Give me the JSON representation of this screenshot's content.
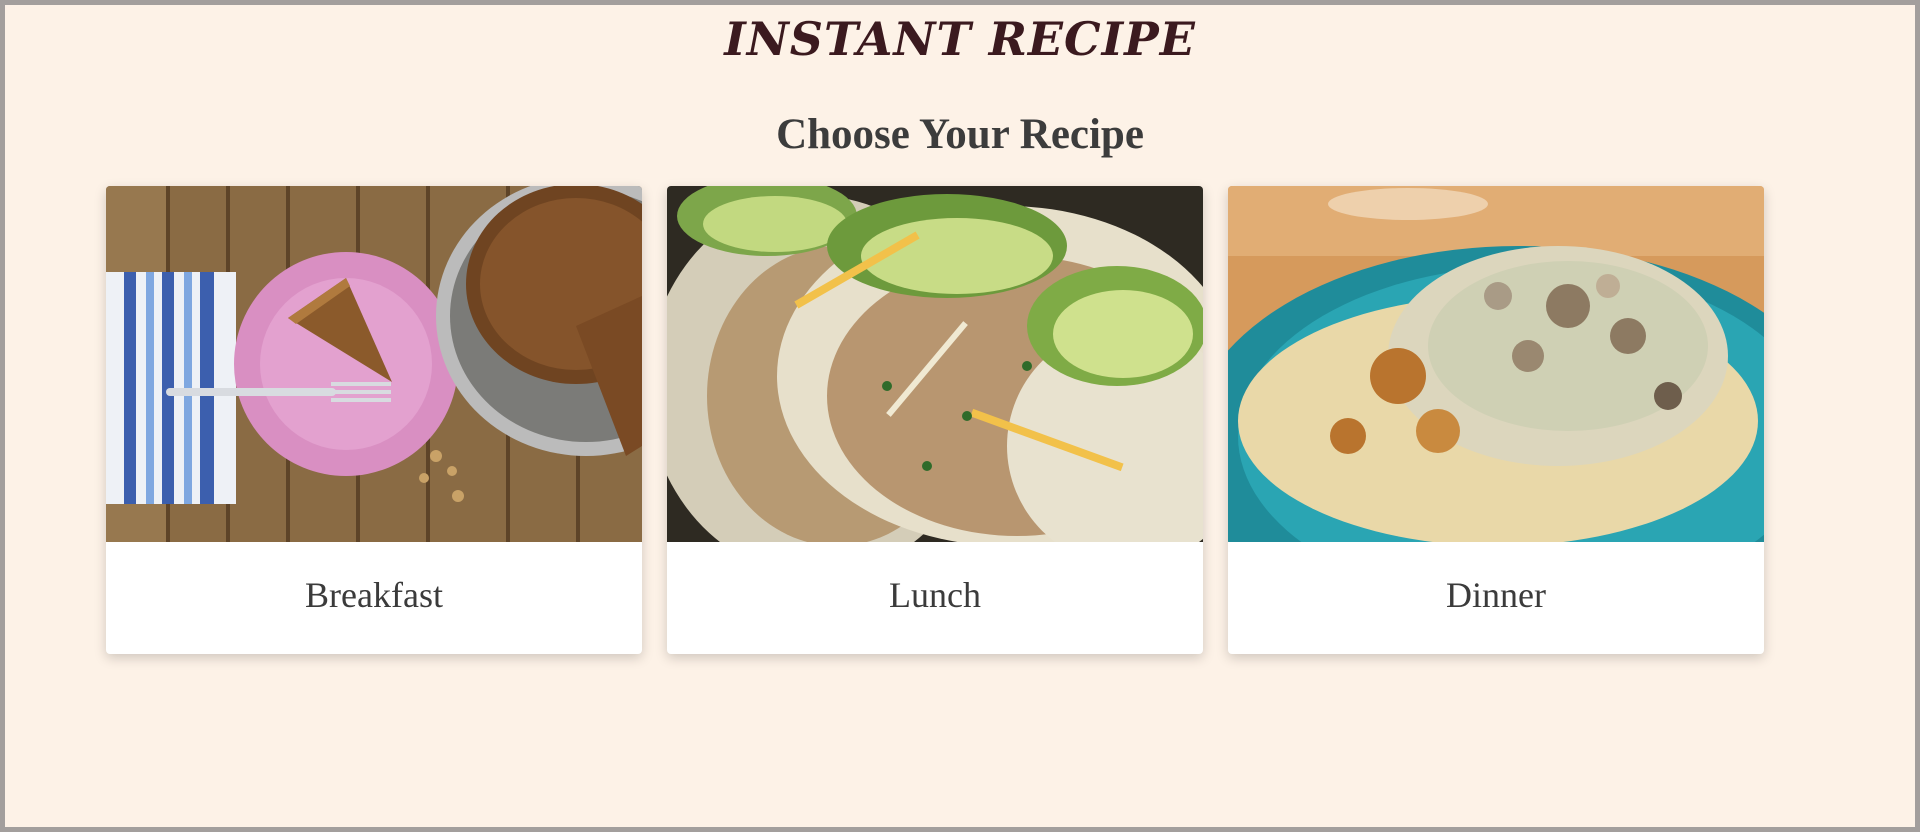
{
  "header": {
    "title": "INSTANT RECIPE",
    "subtitle": "Choose Your Recipe"
  },
  "cards": [
    {
      "label": "Breakfast",
      "image": "breakfast-photo"
    },
    {
      "label": "Lunch",
      "image": "lunch-photo"
    },
    {
      "label": "Dinner",
      "image": "dinner-photo"
    }
  ],
  "colors": {
    "background": "#fdf2e7",
    "frame": "#a39f9d",
    "title": "#3b1a1f",
    "text": "#3c3c3c",
    "card": "#ffffff"
  }
}
